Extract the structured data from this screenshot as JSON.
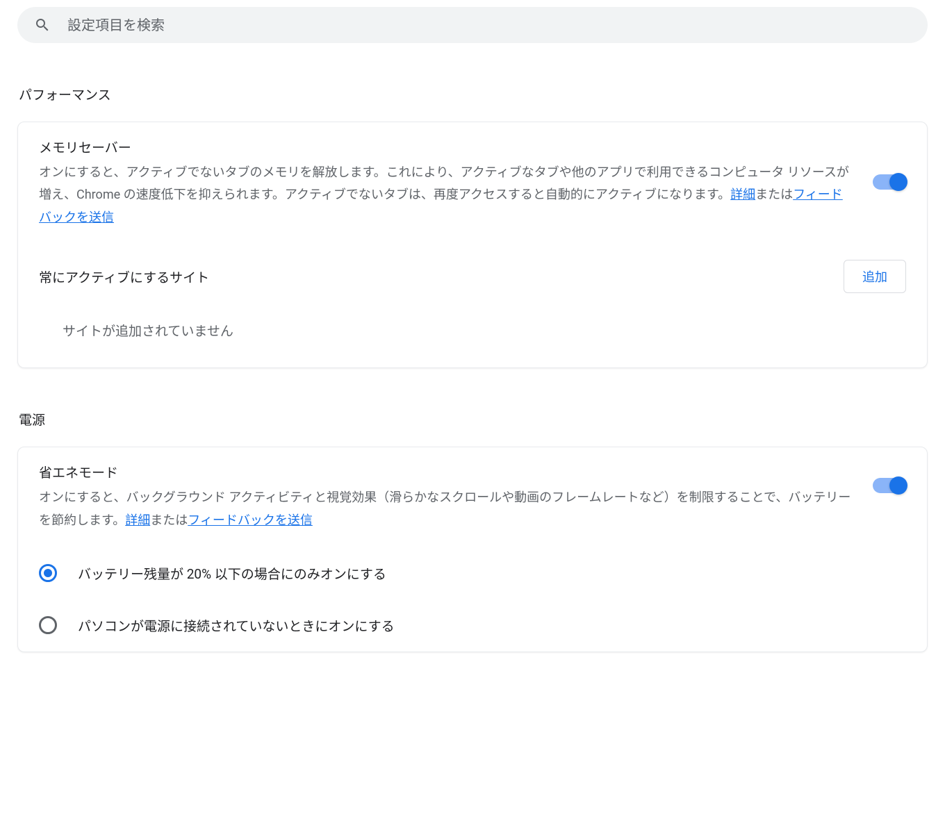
{
  "search": {
    "placeholder": "設定項目を検索"
  },
  "performance": {
    "section_title": "パフォーマンス",
    "memory_saver": {
      "title": "メモリセーバー",
      "desc_part1": "オンにすると、アクティブでないタブのメモリを解放します。これにより、アクティブなタブや他のアプリで利用できるコンピュータ リソースが増え、Chrome の速度低下を抑えられます。アクティブでないタブは、再度アクセスすると自動的にアクティブになります。",
      "link_detail": "詳細",
      "or_text": "または",
      "link_feedback": "フィードバックを送信"
    },
    "active_sites": {
      "label": "常にアクティブにするサイト",
      "add_button": "追加",
      "empty_text": "サイトが追加されていません"
    }
  },
  "power": {
    "section_title": "電源",
    "energy_saver": {
      "title": "省エネモード",
      "desc_part1": "オンにすると、バックグラウンド アクティビティと視覚効果（滑らかなスクロールや動画のフレームレートなど）を制限することで、バッテリーを節約します。",
      "link_detail": "詳細",
      "or_text": "または",
      "link_feedback": "フィードバックを送信"
    },
    "radio_options": {
      "option1": "バッテリー残量が 20% 以下の場合にのみオンにする",
      "option2": "パソコンが電源に接続されていないときにオンにする"
    }
  }
}
